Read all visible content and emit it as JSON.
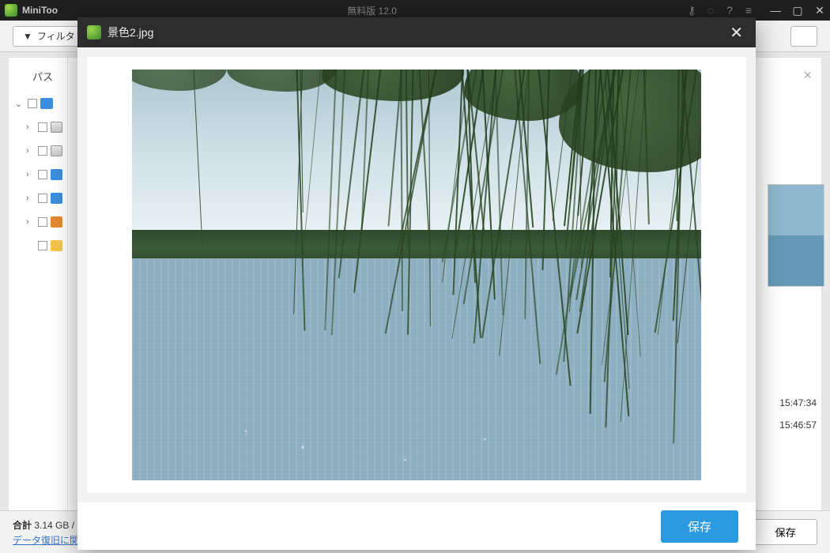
{
  "app": {
    "brand": "MiniToo",
    "title_center": "無料版  12.0"
  },
  "toolbar": {
    "filter_label": "フィルタ"
  },
  "sidebar": {
    "path_header": "パス"
  },
  "content": {
    "timestamp1": "15:47:34",
    "timestamp2": "15:46:57"
  },
  "footer": {
    "total_label": "合計",
    "total_size": "3.14 GB /",
    "link_text": "データ復旧に関",
    "save_label": "保存"
  },
  "modal": {
    "filename": "景色2.jpg",
    "save_label": "保存"
  }
}
